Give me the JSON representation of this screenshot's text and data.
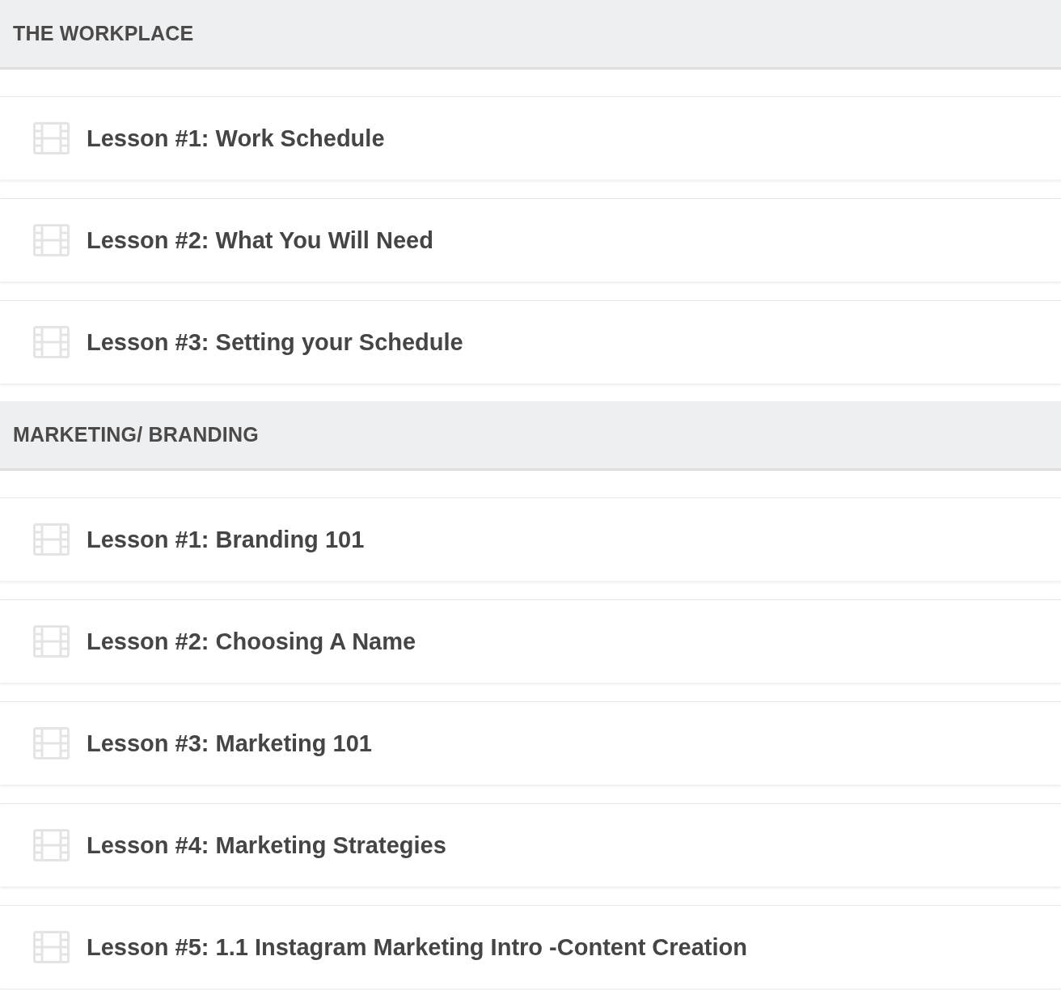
{
  "sections": [
    {
      "title": "THE WORKPLACE",
      "lessons": [
        {
          "title": "Lesson #1: Work Schedule"
        },
        {
          "title": "Lesson #2: What You Will Need"
        },
        {
          "title": "Lesson #3: Setting your Schedule"
        }
      ]
    },
    {
      "title": "MARKETING/ BRANDING",
      "lessons": [
        {
          "title": "Lesson #1: Branding 101"
        },
        {
          "title": "Lesson #2: Choosing A Name"
        },
        {
          "title": "Lesson #3: Marketing 101"
        },
        {
          "title": "Lesson #4: Marketing Strategies"
        },
        {
          "title": "Lesson #5: 1.1 Instagram Marketing Intro -Content Creation"
        }
      ]
    }
  ]
}
